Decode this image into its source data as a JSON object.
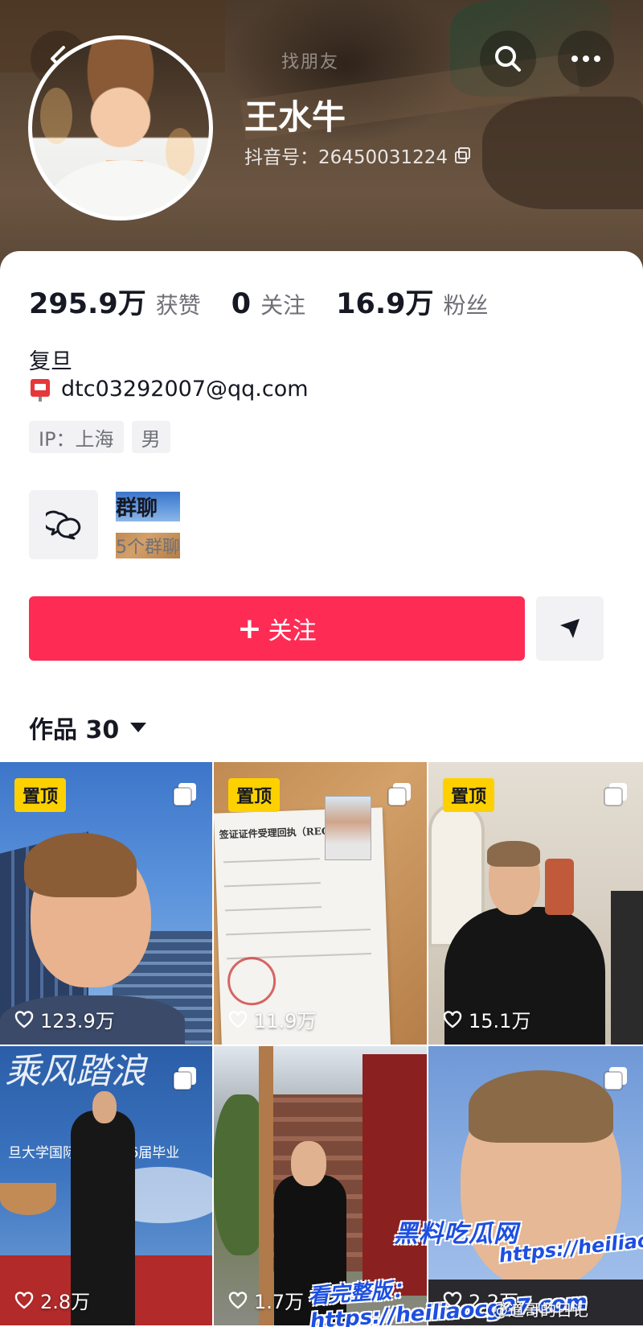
{
  "header": {
    "center_label": "找朋友",
    "icons": {
      "back": "back-chevron-icon",
      "search": "search-icon",
      "more": "more-dots-icon"
    }
  },
  "profile": {
    "name": "王水牛",
    "douyin_id": "抖音号：26450031224",
    "stats": [
      {
        "value": "295.9万",
        "label": "获赞"
      },
      {
        "value": "0",
        "label": "关注"
      },
      {
        "value": "16.9万",
        "label": "粉丝"
      }
    ],
    "bio": "复旦",
    "email": "dtc03292007@qq.com",
    "tags": [
      "IP：上海",
      "男"
    ]
  },
  "group_chat": {
    "title": "群聊",
    "subtitle": "5个群聊"
  },
  "actions": {
    "follow_label": "关注",
    "follow_plus": "+",
    "follow_color": "#fe2c55"
  },
  "works_tab": {
    "label": "作品 30"
  },
  "videos": [
    {
      "pinned": true,
      "pin_label": "置顶",
      "likes": "123.9万",
      "multi": true
    },
    {
      "pinned": true,
      "pin_label": "置顶",
      "likes": "11.9万",
      "multi": true,
      "doc_header": "签证证件受理回执（RECEIPT）"
    },
    {
      "pinned": true,
      "pin_label": "置顶",
      "likes": "15.1万",
      "multi": true
    },
    {
      "pinned": false,
      "likes": "2.8万",
      "multi": true,
      "banner_text": "乘风踏浪",
      "banner_sub": "旦大学国际文化2026届毕业"
    },
    {
      "pinned": false,
      "likes": "1.7万",
      "multi": false
    },
    {
      "pinned": false,
      "likes": "2.2万",
      "multi": true
    }
  ],
  "watermarks": {
    "site_name": "黑料吃瓜网",
    "site_url": "https://heiliaocg27.com",
    "full_version": "看完整版：https://heiliaocg27.com",
    "weibo": "@道哥的日记"
  },
  "colors": {
    "accent": "#fe2c55",
    "pin_badge": "#fdd100",
    "watermark": "#1d4fe0"
  }
}
